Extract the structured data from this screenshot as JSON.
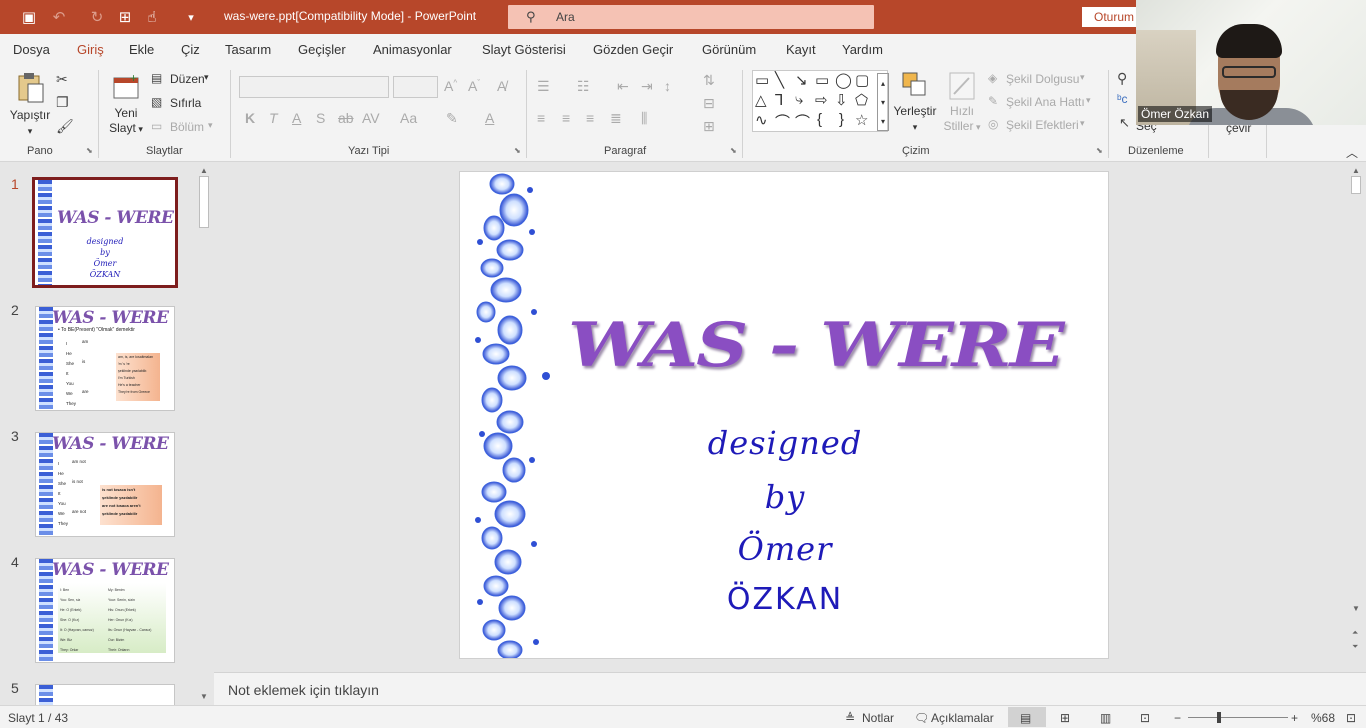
{
  "titlebar": {
    "document_title": "was-were.ppt[Compatibility Mode]  -  PowerPoint",
    "search_placeholder": "Ara",
    "signin_label": "Oturum",
    "bg_color": "#b7472a"
  },
  "menu": {
    "tabs": [
      "Dosya",
      "Giriş",
      "Ekle",
      "Çiz",
      "Tasarım",
      "Geçişler",
      "Animasyonlar",
      "Slayt Gösterisi",
      "Gözden Geçir",
      "Görünüm",
      "Kayıt",
      "Yardım"
    ],
    "active": "Giriş"
  },
  "ribbon": {
    "pano": {
      "label": "Pano",
      "paste": "Yapıştır"
    },
    "slaytlar": {
      "label": "Slaytlar",
      "new_slide": "Yeni",
      "new_slide2": "Slayt",
      "layout": "Düzen",
      "reset": "Sıfırla",
      "section": "Bölüm"
    },
    "yazi_tipi": {
      "label": "Yazı Tipi"
    },
    "paragraf": {
      "label": "Paragraf"
    },
    "cizim": {
      "label": "Çizim",
      "arrange": "Yerleştir",
      "quick_styles": "Hızlı",
      "quick_styles2": "Stiller",
      "shape_fill": "Şekil Dolgusu",
      "shape_outline": "Şekil Ana Hattı",
      "shape_effects": "Şekil Efektleri"
    },
    "duzenleme": {
      "label": "Düzenleme",
      "select": "Seç",
      "replace": "çevir"
    }
  },
  "thumbnails": {
    "numbers": [
      "1",
      "2",
      "3",
      "4",
      "5"
    ],
    "title_text": "WAS - WERE",
    "t1_lines": [
      "designed",
      "by",
      "Ömer",
      "ÖZKAN"
    ],
    "t2_header": "• To BE(Present)    \"Olmak\" demektir",
    "t2_pronouns": [
      "I",
      "He",
      "She",
      "It",
      "You",
      "We",
      "They"
    ],
    "t2_verbs": [
      "am",
      "is",
      "are"
    ],
    "t2_box": [
      "am, is, are kısaltmaları",
      "'m   's   're",
      "şeklinde yazılabilir.",
      "I'm Turkish",
      "He's a teacher",
      "They're from Greece"
    ],
    "t3_pronouns": [
      "I",
      "He",
      "She",
      "It",
      "You",
      "We",
      "They"
    ],
    "t3_verbs": [
      "am not",
      "is not",
      "are not"
    ],
    "t3_box": [
      "is not kısaca isn't",
      "şeklinde yazılabilir",
      "are not kısaca aren't",
      "şeklinde yazılabilir"
    ],
    "t4_left": [
      "I: Ben",
      "You: Sen, siz",
      "He: O (Erkek)",
      "She: O (Kız)",
      "It: O (Hayvan, cansız)",
      "We: Biz",
      "They: Onlar"
    ],
    "t4_right": [
      "My: Benim",
      "Your: Senin, sizin",
      "His: Onun (Erkek)",
      "Her: Onun (Kız)",
      "Its: Onun (Hayvan - Cansız)",
      "Our: Bizim",
      "Their: Onların"
    ]
  },
  "slide": {
    "title": "WAS - WERE",
    "line1": "designed",
    "line2": "by",
    "line3": "Ömer",
    "line4": "ÖZKAN",
    "title_color": "#8a4ec2",
    "text_color": "#1e1ab8"
  },
  "notes": {
    "placeholder": "Not eklemek için tıklayın"
  },
  "status": {
    "slide_info": "Slayt 1 / 43",
    "notes_btn": "Notlar",
    "comments_btn": "Açıklamalar",
    "zoom_level": "%68"
  },
  "webcam": {
    "name": "Ömer Özkan"
  }
}
